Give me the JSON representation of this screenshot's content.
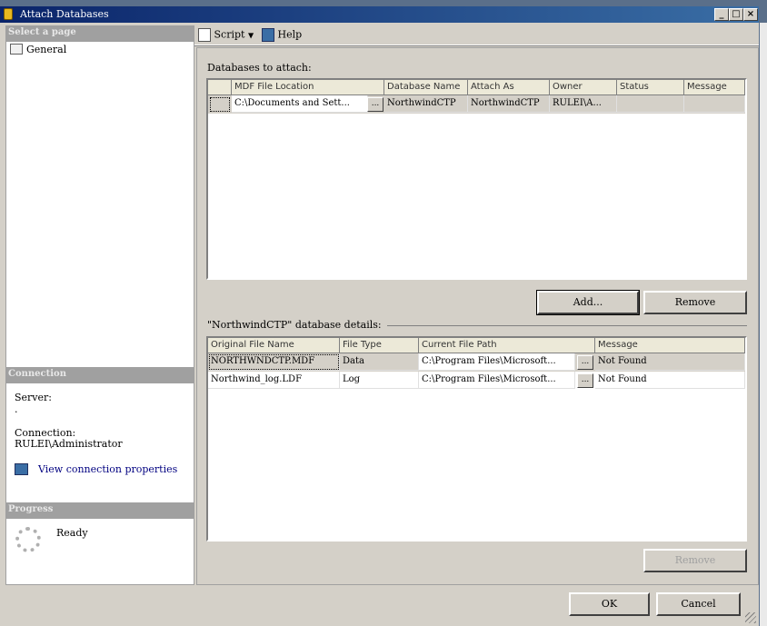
{
  "window": {
    "title": "Attach Databases"
  },
  "sidebar": {
    "select_header": "Select a page",
    "pages": [
      {
        "label": "General"
      }
    ],
    "connection_header": "Connection",
    "server_label": "Server:",
    "server_value": ".",
    "connection_label": "Connection:",
    "connection_value": "RULEI\\Administrator",
    "view_link": "View connection properties",
    "progress_header": "Progress",
    "progress_status": "Ready"
  },
  "toolbar": {
    "script_label": "Script",
    "help_label": "Help"
  },
  "attach": {
    "section_label": "Databases to attach:",
    "columns": [
      "MDF File Location",
      "Database Name",
      "Attach As",
      "Owner",
      "Status",
      "Message"
    ],
    "rows": [
      {
        "mdf": "C:\\Documents and Sett...",
        "db_name": "NorthwindCTP",
        "attach_as": "NorthwindCTP",
        "owner": "RULEI\\A...",
        "status": "",
        "message": ""
      }
    ],
    "add_button": "Add...",
    "remove_button": "Remove"
  },
  "details": {
    "section_label": "\"NorthwindCTP\" database details:",
    "columns": [
      "Original File Name",
      "File Type",
      "Current File Path",
      "Message"
    ],
    "rows": [
      {
        "orig": "NORTHWNDCTP.MDF",
        "type": "Data",
        "path": "C:\\Program Files\\Microsoft...",
        "message": "Not Found"
      },
      {
        "orig": "Northwind_log.LDF",
        "type": "Log",
        "path": "C:\\Program Files\\Microsoft...",
        "message": "Not Found"
      }
    ],
    "remove_button": "Remove"
  },
  "footer": {
    "ok_button": "OK",
    "cancel_button": "Cancel"
  }
}
